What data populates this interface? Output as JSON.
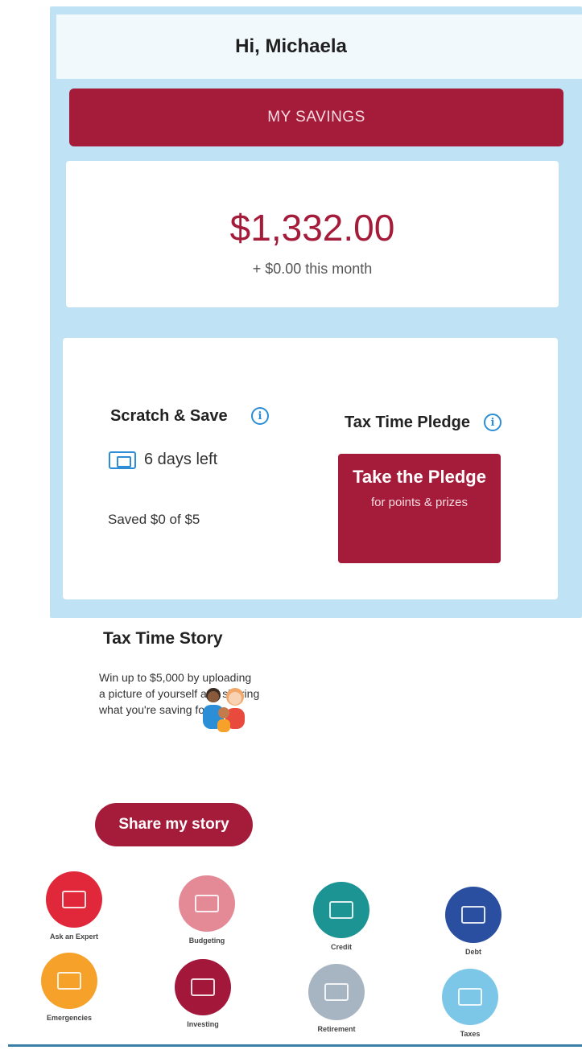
{
  "header": {
    "greeting": "Hi, Michaela"
  },
  "savings": {
    "tab_label": "MY SAVINGS",
    "balance": "$1,332.00",
    "this_month": "+ $0.00 this month"
  },
  "scratch_save": {
    "title": "Scratch & Save",
    "days_left": "6 days left",
    "saved": "Saved $0 of $5",
    "icon": "ticket-icon"
  },
  "pledge": {
    "title": "Tax Time Pledge",
    "button_main": "Take the Pledge",
    "button_sub": "for points & prizes"
  },
  "story": {
    "title": "Tax Time Story",
    "text": "Win up to $5,000 by uploading a picture of yourself and sharing what you're saving for!",
    "button": "Share my story"
  },
  "categories": [
    {
      "label": "Ask an Expert",
      "color": "#e0283a",
      "icon": "chat-bubbles-icon"
    },
    {
      "label": "Budgeting",
      "color": "#e48a97",
      "icon": "wallet-icon"
    },
    {
      "label": "Credit",
      "color": "#1b9493",
      "icon": "credit-card-icon"
    },
    {
      "label": "Debt",
      "color": "#2a4fa0",
      "icon": "document-icon"
    },
    {
      "label": "Emergencies",
      "color": "#f6a22a",
      "icon": "alarm-icon"
    },
    {
      "label": "Investing",
      "color": "#a3173b",
      "icon": "plant-icon"
    },
    {
      "label": "Retirement",
      "color": "#a7b4c1",
      "icon": "house-icon"
    },
    {
      "label": "Taxes",
      "color": "#7cc7e8",
      "icon": "tax-form-icon"
    }
  ]
}
